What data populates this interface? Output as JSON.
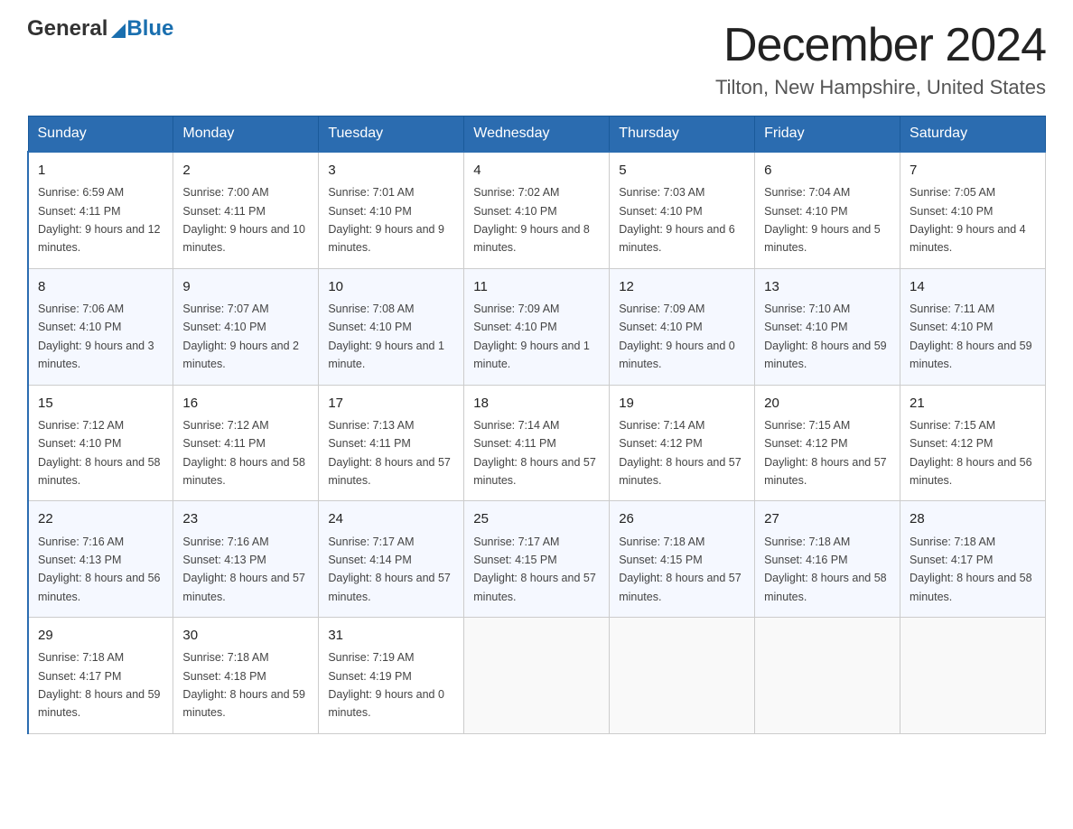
{
  "logo": {
    "general": "General",
    "blue": "Blue"
  },
  "header": {
    "month_year": "December 2024",
    "location": "Tilton, New Hampshire, United States"
  },
  "days_of_week": [
    "Sunday",
    "Monday",
    "Tuesday",
    "Wednesday",
    "Thursday",
    "Friday",
    "Saturday"
  ],
  "weeks": [
    [
      {
        "day": 1,
        "sunrise": "6:59 AM",
        "sunset": "4:11 PM",
        "daylight": "9 hours and 12 minutes."
      },
      {
        "day": 2,
        "sunrise": "7:00 AM",
        "sunset": "4:11 PM",
        "daylight": "9 hours and 10 minutes."
      },
      {
        "day": 3,
        "sunrise": "7:01 AM",
        "sunset": "4:10 PM",
        "daylight": "9 hours and 9 minutes."
      },
      {
        "day": 4,
        "sunrise": "7:02 AM",
        "sunset": "4:10 PM",
        "daylight": "9 hours and 8 minutes."
      },
      {
        "day": 5,
        "sunrise": "7:03 AM",
        "sunset": "4:10 PM",
        "daylight": "9 hours and 6 minutes."
      },
      {
        "day": 6,
        "sunrise": "7:04 AM",
        "sunset": "4:10 PM",
        "daylight": "9 hours and 5 minutes."
      },
      {
        "day": 7,
        "sunrise": "7:05 AM",
        "sunset": "4:10 PM",
        "daylight": "9 hours and 4 minutes."
      }
    ],
    [
      {
        "day": 8,
        "sunrise": "7:06 AM",
        "sunset": "4:10 PM",
        "daylight": "9 hours and 3 minutes."
      },
      {
        "day": 9,
        "sunrise": "7:07 AM",
        "sunset": "4:10 PM",
        "daylight": "9 hours and 2 minutes."
      },
      {
        "day": 10,
        "sunrise": "7:08 AM",
        "sunset": "4:10 PM",
        "daylight": "9 hours and 1 minute."
      },
      {
        "day": 11,
        "sunrise": "7:09 AM",
        "sunset": "4:10 PM",
        "daylight": "9 hours and 1 minute."
      },
      {
        "day": 12,
        "sunrise": "7:09 AM",
        "sunset": "4:10 PM",
        "daylight": "9 hours and 0 minutes."
      },
      {
        "day": 13,
        "sunrise": "7:10 AM",
        "sunset": "4:10 PM",
        "daylight": "8 hours and 59 minutes."
      },
      {
        "day": 14,
        "sunrise": "7:11 AM",
        "sunset": "4:10 PM",
        "daylight": "8 hours and 59 minutes."
      }
    ],
    [
      {
        "day": 15,
        "sunrise": "7:12 AM",
        "sunset": "4:10 PM",
        "daylight": "8 hours and 58 minutes."
      },
      {
        "day": 16,
        "sunrise": "7:12 AM",
        "sunset": "4:11 PM",
        "daylight": "8 hours and 58 minutes."
      },
      {
        "day": 17,
        "sunrise": "7:13 AM",
        "sunset": "4:11 PM",
        "daylight": "8 hours and 57 minutes."
      },
      {
        "day": 18,
        "sunrise": "7:14 AM",
        "sunset": "4:11 PM",
        "daylight": "8 hours and 57 minutes."
      },
      {
        "day": 19,
        "sunrise": "7:14 AM",
        "sunset": "4:12 PM",
        "daylight": "8 hours and 57 minutes."
      },
      {
        "day": 20,
        "sunrise": "7:15 AM",
        "sunset": "4:12 PM",
        "daylight": "8 hours and 57 minutes."
      },
      {
        "day": 21,
        "sunrise": "7:15 AM",
        "sunset": "4:12 PM",
        "daylight": "8 hours and 56 minutes."
      }
    ],
    [
      {
        "day": 22,
        "sunrise": "7:16 AM",
        "sunset": "4:13 PM",
        "daylight": "8 hours and 56 minutes."
      },
      {
        "day": 23,
        "sunrise": "7:16 AM",
        "sunset": "4:13 PM",
        "daylight": "8 hours and 57 minutes."
      },
      {
        "day": 24,
        "sunrise": "7:17 AM",
        "sunset": "4:14 PM",
        "daylight": "8 hours and 57 minutes."
      },
      {
        "day": 25,
        "sunrise": "7:17 AM",
        "sunset": "4:15 PM",
        "daylight": "8 hours and 57 minutes."
      },
      {
        "day": 26,
        "sunrise": "7:18 AM",
        "sunset": "4:15 PM",
        "daylight": "8 hours and 57 minutes."
      },
      {
        "day": 27,
        "sunrise": "7:18 AM",
        "sunset": "4:16 PM",
        "daylight": "8 hours and 58 minutes."
      },
      {
        "day": 28,
        "sunrise": "7:18 AM",
        "sunset": "4:17 PM",
        "daylight": "8 hours and 58 minutes."
      }
    ],
    [
      {
        "day": 29,
        "sunrise": "7:18 AM",
        "sunset": "4:17 PM",
        "daylight": "8 hours and 59 minutes."
      },
      {
        "day": 30,
        "sunrise": "7:18 AM",
        "sunset": "4:18 PM",
        "daylight": "8 hours and 59 minutes."
      },
      {
        "day": 31,
        "sunrise": "7:19 AM",
        "sunset": "4:19 PM",
        "daylight": "9 hours and 0 minutes."
      },
      null,
      null,
      null,
      null
    ]
  ]
}
